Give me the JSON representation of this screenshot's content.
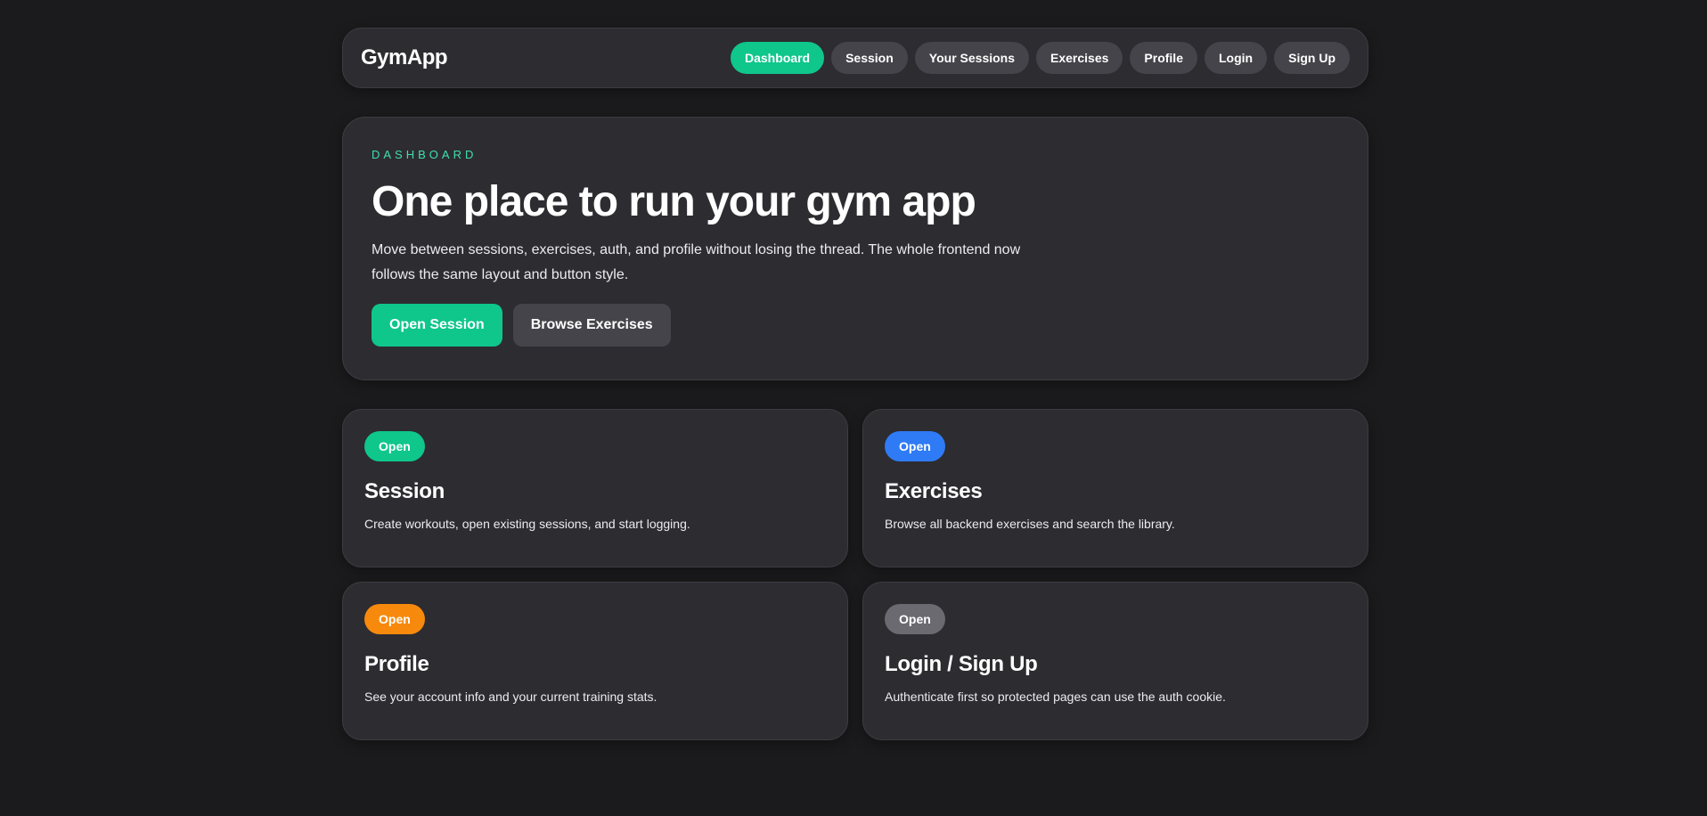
{
  "header": {
    "brand": "GymApp",
    "nav": [
      {
        "label": "Dashboard",
        "active": true
      },
      {
        "label": "Session",
        "active": false
      },
      {
        "label": "Your Sessions",
        "active": false
      },
      {
        "label": "Exercises",
        "active": false
      },
      {
        "label": "Profile",
        "active": false
      },
      {
        "label": "Login",
        "active": false
      },
      {
        "label": "Sign Up",
        "active": false
      }
    ]
  },
  "hero": {
    "eyebrow": "DASHBOARD",
    "title": "One place to run your gym app",
    "description": "Move between sessions, exercises, auth, and profile without losing the thread. The whole frontend now follows the same layout and button style.",
    "primary_button": "Open Session",
    "secondary_button": "Browse Exercises"
  },
  "cards": [
    {
      "badge": "Open",
      "badge_color": "#0fc68b",
      "title": "Session",
      "description": "Create workouts, open existing sessions, and start logging."
    },
    {
      "badge": "Open",
      "badge_color": "#2f7bf5",
      "title": "Exercises",
      "description": "Browse all backend exercises and search the library."
    },
    {
      "badge": "Open",
      "badge_color": "#f78a0c",
      "title": "Profile",
      "description": "See your account info and your current training stats."
    },
    {
      "badge": "Open",
      "badge_color": "#6b6a71",
      "title": "Login / Sign Up",
      "description": "Authenticate first so protected pages can use the auth cookie."
    }
  ],
  "colors": {
    "background": "#1b1b1d",
    "surface": "#2d2c31",
    "accent": "#0fc68b",
    "neutral_button": "#45444a"
  }
}
